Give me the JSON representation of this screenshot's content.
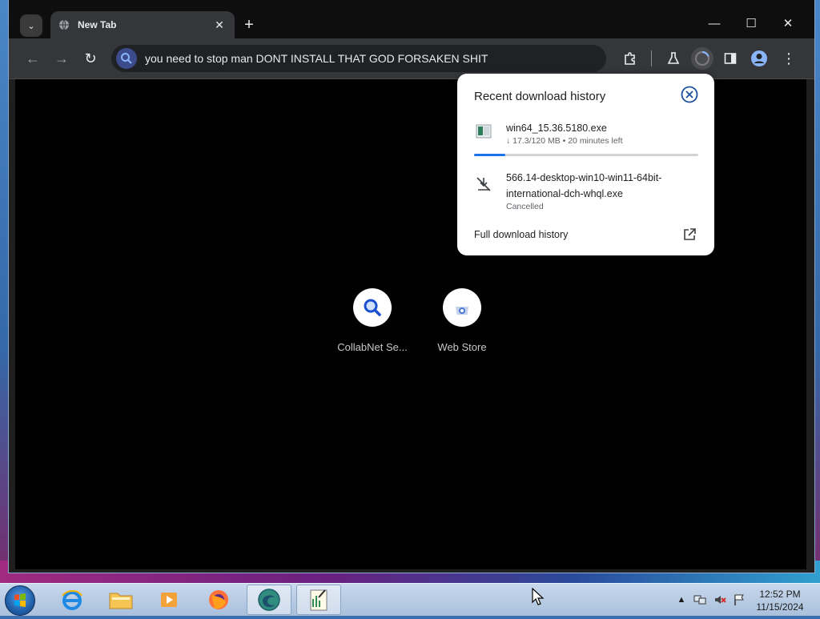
{
  "browser": {
    "tab": {
      "title": "New Tab",
      "close_glyph": "✕"
    },
    "tab_search_glyph": "⌄",
    "new_tab_glyph": "+",
    "window_controls": {
      "minimize": "—",
      "maximize": "☐",
      "close": "✕"
    },
    "toolbar": {
      "back_glyph": "←",
      "forward_glyph": "→",
      "reload_glyph": "↻",
      "address_text": "you need to stop man DONT INSTALL THAT GOD FORSAKEN SHIT",
      "more_glyph": "⋮"
    }
  },
  "downloads_popup": {
    "title": "Recent download history",
    "items": [
      {
        "name": "win64_15.36.5180.exe",
        "status": "↓ 17.3/120 MB • 20 minutes left",
        "progress_fraction": 0.14
      },
      {
        "name": "566.14-desktop-win10-win11-64bit-international-dch-whql.exe",
        "status": "Cancelled"
      }
    ],
    "full_history_label": "Full download history"
  },
  "shortcuts": [
    {
      "label": "CollabNet Se..."
    },
    {
      "label": "Web Store"
    }
  ],
  "taskbar": {
    "time": "12:52 PM",
    "date": "11/15/2024",
    "tray_expand_glyph": "▲"
  },
  "colors": {
    "accent": "#1a73e8",
    "progress_track": "#d3d3d3",
    "popup_bg": "#ffffff",
    "toolbar_bg": "#35363a",
    "content_bg": "#000000"
  }
}
